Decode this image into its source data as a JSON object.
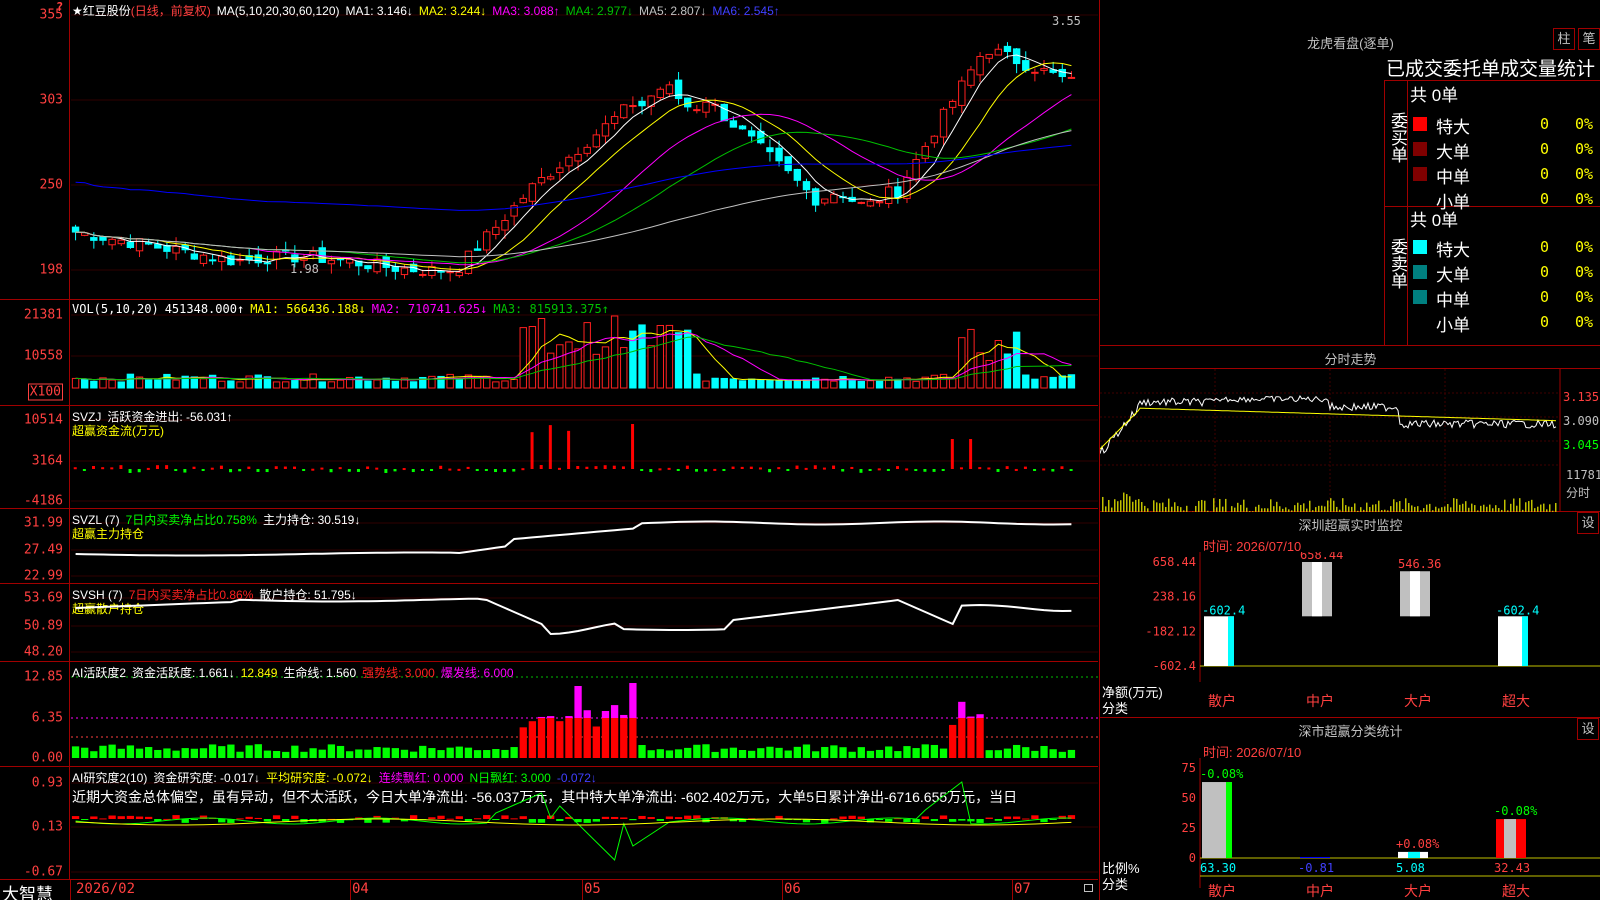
{
  "stock": {
    "title": "★红豆股份",
    "mode": "(日线，前复权)",
    "ma_label": "MA(5,10,20,30,60,120)",
    "ma1": "MA1: 3.146↓",
    "ma2": "MA2: 3.244↓",
    "ma3": "MA3: 3.088↑",
    "ma4": "MA4: 2.977↓",
    "ma5": "MA5: 2.807↓",
    "ma6": "MA6: 2.545↑",
    "y_ticks": [
      "355",
      "303",
      "250",
      "198"
    ],
    "high_label": "3.55",
    "low_label": "1.98",
    "help_icon": "?"
  },
  "vol": {
    "title": "VOL(5,10,20)",
    "val": "451348.000↑",
    "ma1": "MA1: 566436.188↓",
    "ma2": "MA2: 710741.625↓",
    "ma3": "MA3: 815913.375↑",
    "y_ticks": [
      "21381",
      "10558"
    ],
    "unit": "X100"
  },
  "svzj": {
    "title": "SVZJ",
    "text": "活跃资金进出: -56.031↑",
    "sub": "超赢资金流(万元)",
    "y_ticks": [
      "10514",
      "3164",
      "-4186"
    ]
  },
  "svzl": {
    "title": "SVZL (7)",
    "text1": "7日内买卖净占比0.758%",
    "text2": "主力持仓: 30.519↓",
    "sub": "超赢主力持仓",
    "y_ticks": [
      "31.99",
      "27.49",
      "22.99"
    ]
  },
  "svsh": {
    "title": "SVSH (7)",
    "text1": "7日内买卖净占比0.86%",
    "text2": "散户持仓: 51.795↓",
    "sub": "超赢散户持仓",
    "y_ticks": [
      "53.69",
      "50.89",
      "48.20"
    ]
  },
  "ai1": {
    "title": "AI活跃度2",
    "t1": "资金活跃度: 1.661↓",
    "t2": "12.849",
    "t3": "生命线: 1.560",
    "t4": "强势线: 3.000",
    "t5": "爆发线: 6.000",
    "y_ticks": [
      "12.85",
      "6.35",
      "0.00"
    ]
  },
  "ai2": {
    "title": "AI研究度2(10)",
    "t1": "资金研究度: -0.017↓",
    "t2": "平均研究度: -0.072↓",
    "t3": "连续飘红: 0.000",
    "t4": "N日飘红: 3.000",
    "t5": "-0.072↓",
    "desc": "近期大资金总体偏空，虽有异动，但不太活跃，今日大单净流出: -56.037万元，其中特大单净流出: -602.402万元，大单5日累计净出-6716.655万元，当日",
    "y_ticks": [
      "0.93",
      "0.13",
      "-0.67"
    ]
  },
  "bottom": {
    "brand": "大智慧",
    "dates": [
      "2026/02",
      "04",
      "05",
      "06",
      "07"
    ]
  },
  "dragon": {
    "title": "龙虎看盘(逐单)",
    "btn1": "柱",
    "btn2": "笔",
    "header": "已成交委托单成交量统计",
    "buy_label": "委买单",
    "sell_label": "委卖单",
    "buy_total": "共 0单",
    "sell_total": "共 0单",
    "rows": [
      "特大",
      "大单",
      "中单",
      "小单"
    ],
    "zero": "0",
    "pct": "0%",
    "buy_colors": [
      "#ff0000",
      "#800000",
      "#800000",
      "#000000"
    ],
    "sell_colors": [
      "#00ffff",
      "#008080",
      "#008080",
      "#000000"
    ]
  },
  "intraday": {
    "title": "分时走势",
    "prices": [
      "3.135",
      "3.090",
      "3.045"
    ],
    "vol_label": "11781",
    "vol_unit": "分时"
  },
  "sz_monitor": {
    "title": "深圳超赢实时监控",
    "btn": "设",
    "time": "时间: 2026/07/10",
    "y_ticks": [
      "658.44",
      "238.16",
      "-182.12",
      "-602.4"
    ],
    "bars": [
      {
        "cat": "散户",
        "value": -602.4,
        "label": "-602.4"
      },
      {
        "cat": "中户",
        "value": 658.44,
        "label": "658.44"
      },
      {
        "cat": "大户",
        "value": 546.36,
        "label": "546.36"
      },
      {
        "cat": "超大",
        "value": -602.4,
        "label": "-602.4"
      }
    ],
    "axis_name1": "净额(万元)",
    "axis_name2": "分类"
  },
  "sz_class": {
    "title": "深市超赢分类统计",
    "btn": "设",
    "time": "时间: 2026/07/10",
    "y_ticks": [
      "75",
      "50",
      "25",
      "0"
    ],
    "bars": [
      {
        "cat": "散户",
        "value": 63.3,
        "top": "-0.08%",
        "bottom": "63.30"
      },
      {
        "cat": "中户",
        "value": 0.81,
        "top": "",
        "bottom": "-0.81"
      },
      {
        "cat": "大户",
        "value": 5.08,
        "top": "+0.08%",
        "bottom": "5.08"
      },
      {
        "cat": "超大",
        "value": 32.43,
        "top": "-0.08%",
        "bottom": "32.43"
      }
    ],
    "axis_name1": "比例%",
    "axis_name2": "分类"
  },
  "colors": {
    "up": "#ff2020",
    "down": "#00ffff",
    "ma1": "#ffffff",
    "ma2": "#ffff00",
    "ma3": "#ff00ff",
    "ma4": "#00c000",
    "ma5": "#c0c0c0",
    "ma6": "#0000ff",
    "grid": "#a00000"
  }
}
